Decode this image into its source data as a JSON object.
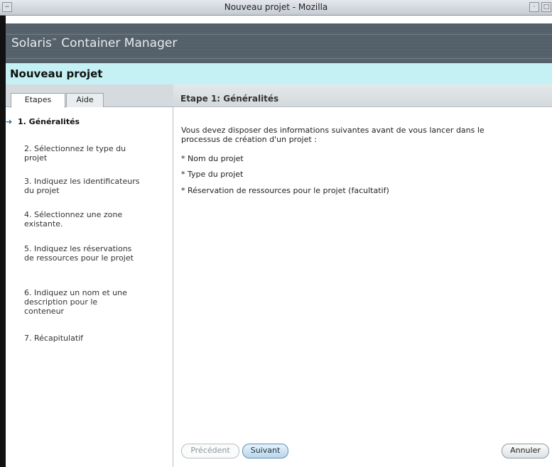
{
  "window": {
    "title": "Nouveau projet - Mozilla"
  },
  "masthead": {
    "brand": "Solaris",
    "brand_tm": "™",
    "brand_rest": " Container Manager"
  },
  "page": {
    "title": "Nouveau projet"
  },
  "tabs": [
    {
      "label": "Etapes",
      "active": true
    },
    {
      "label": "Aide",
      "active": false
    }
  ],
  "steps": [
    {
      "label": "1. Généralités",
      "current": true
    },
    {
      "label": "2. Sélectionnez le type du projet",
      "current": false
    },
    {
      "label": "3. Indiquez les identificateurs du projet",
      "current": false
    },
    {
      "label": "4. Sélectionnez une zone existante.",
      "current": false
    },
    {
      "label": "5. Indiquez les réservations de ressources pour le projet",
      "current": false
    },
    {
      "label": "6. Indiquez un nom et une description pour le conteneur",
      "current": false
    },
    {
      "label": "7. Récapitulatif",
      "current": false
    }
  ],
  "step_panel": {
    "title": "Etape 1:  Généralités",
    "intro": "Vous devez disposer des informations suivantes avant de vous lancer dans le processus de création d'un projet :",
    "bullets": [
      "* Nom du projet",
      "* Type du projet",
      "* Réservation de ressources pour le projet (facultatif)"
    ]
  },
  "buttons": {
    "previous": "Précédent",
    "next": "Suivant",
    "cancel": "Annuler"
  }
}
